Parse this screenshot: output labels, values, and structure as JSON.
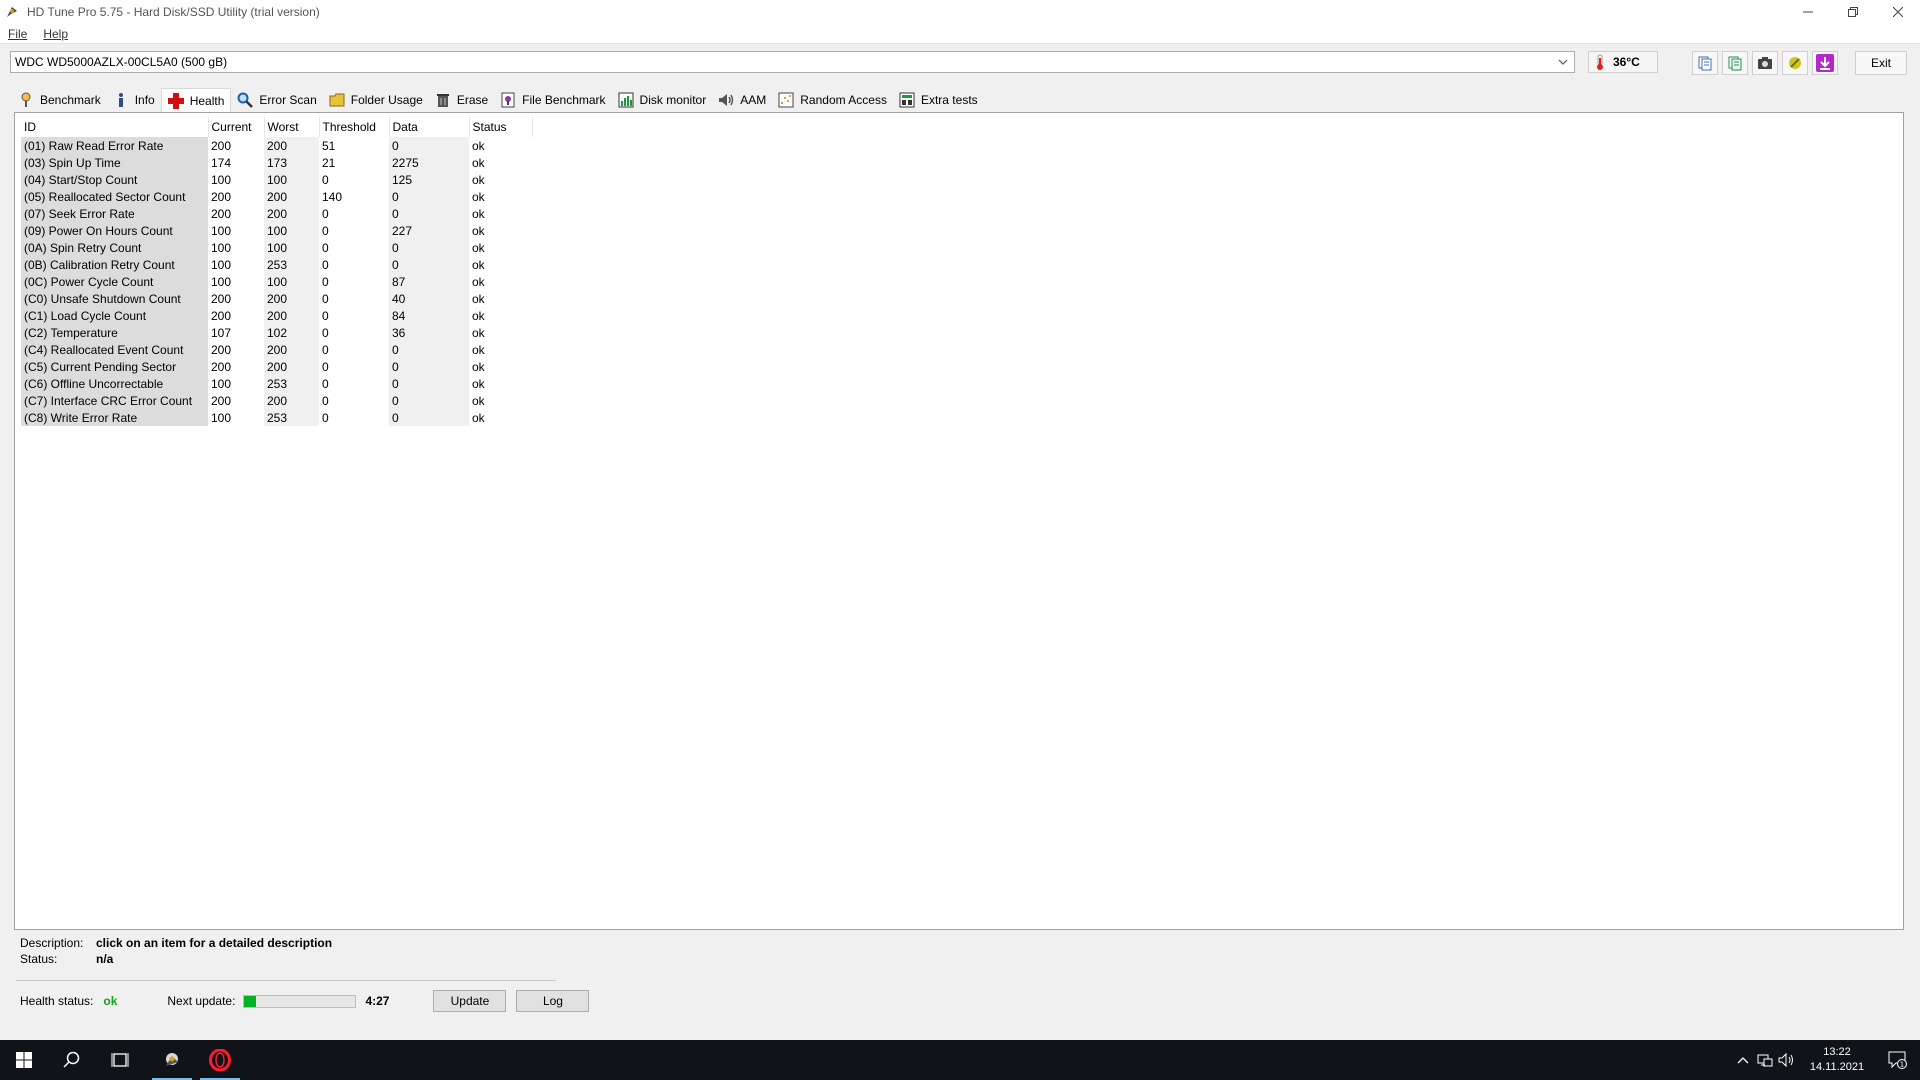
{
  "window": {
    "title": "HD Tune Pro 5.75 - Hard Disk/SSD Utility (trial version)"
  },
  "menu": {
    "file": "File",
    "help": "Help"
  },
  "toolbar": {
    "drive": "WDC WD5000AZLX-00CL5A0 (500 gB)",
    "temperature": "36°C",
    "exit_label": "Exit"
  },
  "tabs": [
    {
      "label": "Benchmark",
      "icon": "benchmark-icon"
    },
    {
      "label": "Info",
      "icon": "info-icon"
    },
    {
      "label": "Health",
      "icon": "health-cross-icon",
      "active": true
    },
    {
      "label": "Error Scan",
      "icon": "magnifier-icon"
    },
    {
      "label": "Folder Usage",
      "icon": "folder-icon"
    },
    {
      "label": "Erase",
      "icon": "trash-icon"
    },
    {
      "label": "File Benchmark",
      "icon": "file-benchmark-icon"
    },
    {
      "label": "Disk monitor",
      "icon": "disk-monitor-icon"
    },
    {
      "label": "AAM",
      "icon": "speaker-icon"
    },
    {
      "label": "Random Access",
      "icon": "random-access-icon"
    },
    {
      "label": "Extra tests",
      "icon": "extra-tests-icon"
    }
  ],
  "table": {
    "headers": {
      "id": "ID",
      "current": "Current",
      "worst": "Worst",
      "threshold": "Threshold",
      "data": "Data",
      "status": "Status"
    },
    "rows": [
      {
        "id": "(01) Raw Read Error Rate",
        "current": "200",
        "worst": "200",
        "threshold": "51",
        "data": "0",
        "status": "ok"
      },
      {
        "id": "(03) Spin Up Time",
        "current": "174",
        "worst": "173",
        "threshold": "21",
        "data": "2275",
        "status": "ok"
      },
      {
        "id": "(04) Start/Stop Count",
        "current": "100",
        "worst": "100",
        "threshold": "0",
        "data": "125",
        "status": "ok"
      },
      {
        "id": "(05) Reallocated Sector Count",
        "current": "200",
        "worst": "200",
        "threshold": "140",
        "data": "0",
        "status": "ok"
      },
      {
        "id": "(07) Seek Error Rate",
        "current": "200",
        "worst": "200",
        "threshold": "0",
        "data": "0",
        "status": "ok"
      },
      {
        "id": "(09) Power On Hours Count",
        "current": "100",
        "worst": "100",
        "threshold": "0",
        "data": "227",
        "status": "ok"
      },
      {
        "id": "(0A) Spin Retry Count",
        "current": "100",
        "worst": "100",
        "threshold": "0",
        "data": "0",
        "status": "ok"
      },
      {
        "id": "(0B) Calibration Retry Count",
        "current": "100",
        "worst": "253",
        "threshold": "0",
        "data": "0",
        "status": "ok"
      },
      {
        "id": "(0C) Power Cycle Count",
        "current": "100",
        "worst": "100",
        "threshold": "0",
        "data": "87",
        "status": "ok"
      },
      {
        "id": "(C0) Unsafe Shutdown Count",
        "current": "200",
        "worst": "200",
        "threshold": "0",
        "data": "40",
        "status": "ok"
      },
      {
        "id": "(C1) Load Cycle Count",
        "current": "200",
        "worst": "200",
        "threshold": "0",
        "data": "84",
        "status": "ok"
      },
      {
        "id": "(C2) Temperature",
        "current": "107",
        "worst": "102",
        "threshold": "0",
        "data": "36",
        "status": "ok"
      },
      {
        "id": "(C4) Reallocated Event Count",
        "current": "200",
        "worst": "200",
        "threshold": "0",
        "data": "0",
        "status": "ok"
      },
      {
        "id": "(C5) Current Pending Sector",
        "current": "200",
        "worst": "200",
        "threshold": "0",
        "data": "0",
        "status": "ok"
      },
      {
        "id": "(C6) Offline Uncorrectable",
        "current": "100",
        "worst": "253",
        "threshold": "0",
        "data": "0",
        "status": "ok"
      },
      {
        "id": "(C7) Interface CRC Error Count",
        "current": "200",
        "worst": "200",
        "threshold": "0",
        "data": "0",
        "status": "ok"
      },
      {
        "id": "(C8) Write Error Rate",
        "current": "100",
        "worst": "253",
        "threshold": "0",
        "data": "0",
        "status": "ok"
      }
    ]
  },
  "details": {
    "description_label": "Description:",
    "description_value": "click on an item for a detailed description",
    "status_label": "Status:",
    "status_value": "n/a"
  },
  "health": {
    "label": "Health status:",
    "value": "ok",
    "next_update_label": "Next update:",
    "next_update_progress": 0.1,
    "next_update_time": "4:27",
    "update_label": "Update",
    "log_label": "Log"
  },
  "taskbar": {
    "time": "13:22",
    "date": "14.11.2021",
    "notifications": "1"
  },
  "colors": {
    "ok_green": "#1aa01a",
    "progress_green": "#06b025",
    "taskbar_bg": "#101418"
  }
}
